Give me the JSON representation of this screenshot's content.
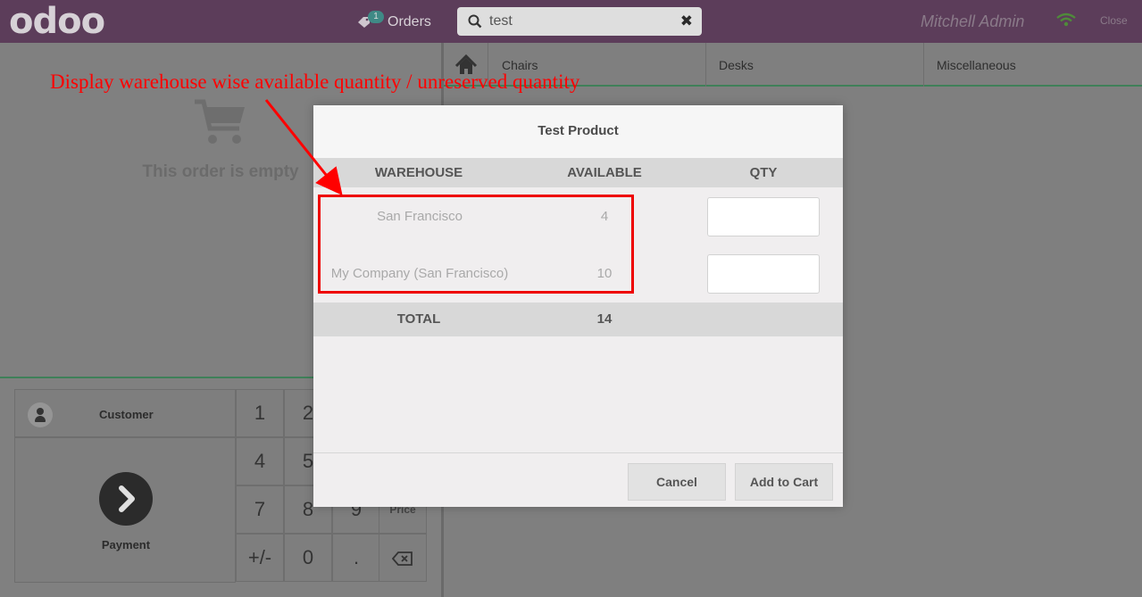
{
  "topbar": {
    "logo": "odoo",
    "orders_label": "Orders",
    "orders_badge": "1",
    "search_value": "test",
    "user": "Mitchell Admin",
    "close_label": "Close"
  },
  "order": {
    "empty_text": "This order is empty"
  },
  "controls": {
    "customer_label": "Customer",
    "payment_label": "Payment",
    "keys": [
      "1",
      "2",
      "4",
      "5",
      "7",
      "8",
      "9",
      "Price",
      "+/-",
      "0",
      "."
    ]
  },
  "categories": {
    "items": [
      "Chairs",
      "Desks",
      "Miscellaneous"
    ]
  },
  "annotation": {
    "text": "Display warehouse wise available quantity / unreserved quantity"
  },
  "modal": {
    "title": "Test Product",
    "headers": [
      "WAREHOUSE",
      "AVAILABLE",
      "QTY"
    ],
    "rows": [
      {
        "warehouse": "San Francisco",
        "available": "4",
        "qty": ""
      },
      {
        "warehouse": "My Company (San Francisco)",
        "available": "10",
        "qty": ""
      }
    ],
    "total_label": "TOTAL",
    "total_value": "14",
    "cancel_label": "Cancel",
    "add_label": "Add to Cart"
  },
  "colors": {
    "topbar": "#5c3d5a",
    "accent_green": "#3f8059",
    "annotation_red": "#ff0000"
  }
}
